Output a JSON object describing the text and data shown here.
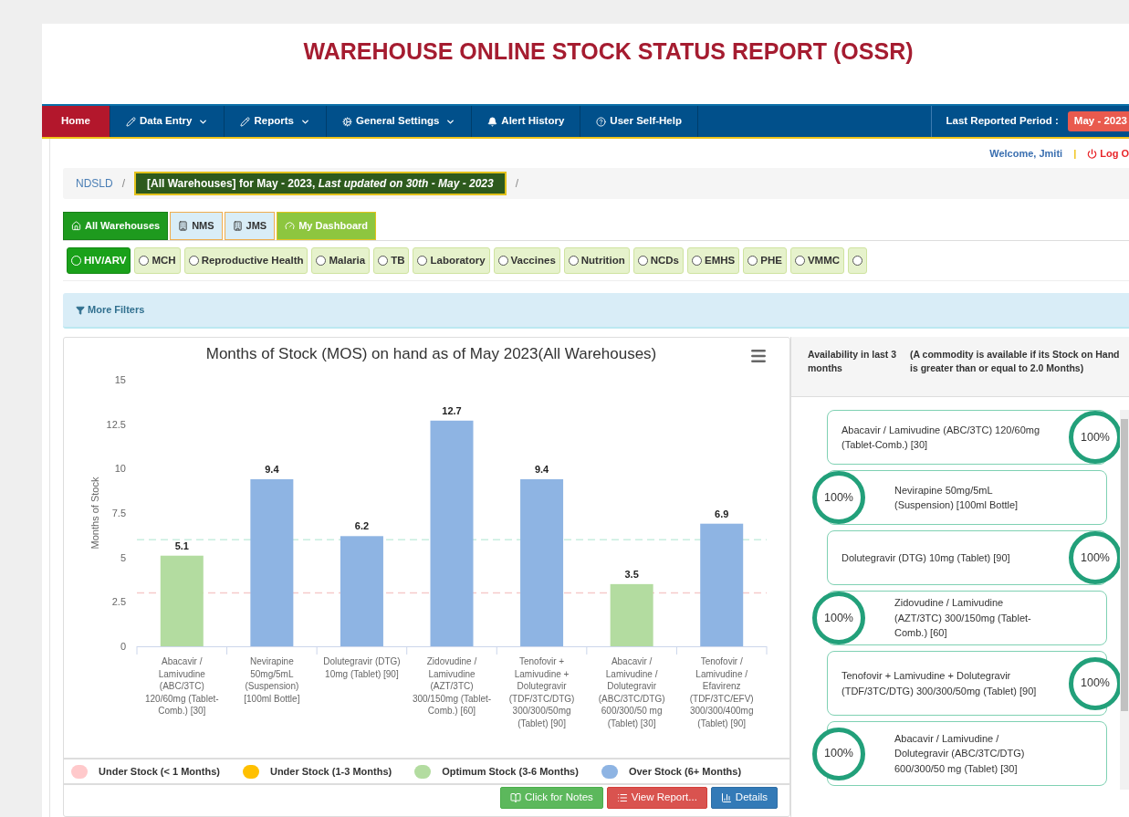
{
  "page_title": "WAREHOUSE ONLINE STOCK STATUS REPORT (OSSR)",
  "nav": {
    "items": [
      {
        "label": "Home",
        "selected": true,
        "dropdown": false
      },
      {
        "label": "Data Entry",
        "selected": false,
        "dropdown": true
      },
      {
        "label": "Reports",
        "selected": false,
        "dropdown": true
      },
      {
        "label": "General Settings",
        "selected": false,
        "dropdown": true
      },
      {
        "label": "Alert History",
        "selected": false,
        "dropdown": false
      },
      {
        "label": "User Self-Help",
        "selected": false,
        "dropdown": false
      }
    ],
    "period_label": "Last Reported Period :",
    "period_value": "May - 2023"
  },
  "user": {
    "welcome": "Welcome, Jmiti",
    "separator": "|",
    "logout": "Log O"
  },
  "breadcrumb": {
    "root": "NDSLD",
    "separator": "/",
    "current": "[All Warehouses] for May - 2023, *Last updated on 30th - May - 2023*",
    "trailing": "/"
  },
  "warehouse_tabs": [
    {
      "label": "All Warehouses",
      "kind": "warehouse",
      "selected": true
    },
    {
      "label": "NMS",
      "kind": "warehouse",
      "selected": false
    },
    {
      "label": "JMS",
      "kind": "warehouse",
      "selected": false
    },
    {
      "label": "My Dashboard",
      "kind": "dashboard",
      "selected": false
    }
  ],
  "programs": [
    {
      "label": "HIV/ARV",
      "selected": true
    },
    {
      "label": "MCH",
      "selected": false
    },
    {
      "label": "Reproductive Health",
      "selected": false
    },
    {
      "label": "Malaria",
      "selected": false
    },
    {
      "label": "TB",
      "selected": false
    },
    {
      "label": "Laboratory",
      "selected": false
    },
    {
      "label": "Vaccines",
      "selected": false
    },
    {
      "label": "Nutrition",
      "selected": false
    },
    {
      "label": "NCDs",
      "selected": false
    },
    {
      "label": "EMHS",
      "selected": false
    },
    {
      "label": "PHE",
      "selected": false
    },
    {
      "label": "VMMC",
      "selected": false
    },
    {
      "selected": false
    }
  ],
  "filters": {
    "label": "More Filters"
  },
  "chart_panel": {
    "chart_data": {
      "type": "bar",
      "title": "Months of Stock (MOS) on hand as of May 2023(All Warehouses)",
      "ylabel": "Months of Stock",
      "categories": [
        "Abacavir / Lamivudine (ABC/3TC) 120/60mg (Tablet-Comb.) [30]",
        "Nevirapine 50mg/5mL (Suspension) [100ml Bottle]",
        "Dolutegravir (DTG) 10mg (Tablet) [90]",
        "Zidovudine / Lamivudine (AZT/3TC) 300/150mg (Tablet-Comb.) [60]",
        "Tenofovir + Lamivudine + Dolutegravir (TDF/3TC/DTG) 300/300/50mg (Tablet) [90]",
        "Abacavir / Lamivudine / Dolutegravir (ABC/3TC/DTG) 600/300/50 mg (Tablet) [30]",
        "Tenofovir / Lamivudine / Efavirenz (TDF/3TC/EFV) 300/300/400mg (Tablet) [90]"
      ],
      "series": [
        {
          "name": "Under Stock (< 1 Months)",
          "color": "#ffc9cb",
          "values": [
            null,
            null,
            null,
            null,
            null,
            null,
            null
          ]
        },
        {
          "name": "Under Stock (1-3 Months)",
          "color": "#ffc000",
          "values": [
            null,
            null,
            null,
            null,
            null,
            null,
            null
          ]
        },
        {
          "name": "Optimum Stock (3-6 Months)",
          "color": "#b3dca0",
          "values": [
            5.1,
            null,
            null,
            null,
            null,
            3.5,
            null
          ]
        },
        {
          "name": "Over Stock (6+ Months)",
          "color": "#8eb4e3",
          "values": [
            null,
            9.4,
            6.2,
            12.7,
            9.4,
            null,
            6.9
          ]
        }
      ],
      "ylim": [
        0,
        15
      ],
      "yticks": [
        0,
        2.5,
        5,
        7.5,
        10,
        12.5,
        15
      ],
      "data_labels": true,
      "ref_lines": [
        {
          "axis": "y",
          "value": 3,
          "color": "#f6caca"
        },
        {
          "axis": "y",
          "value": 6,
          "color": "#c8eee0"
        }
      ]
    },
    "buttons": [
      {
        "label": "Click for Notes",
        "kind": "notes"
      },
      {
        "label": "View Report...",
        "kind": "report"
      },
      {
        "label": "Details",
        "kind": "details"
      }
    ]
  },
  "availability": {
    "title": "Availability in last 3 months",
    "note": "(A commodity is available if its Stock on Hand is greater than or equal to 2.0 Months)",
    "items": [
      {
        "name": "Abacavir / Lamivudine (ABC/3TC) 120/60mg (Tablet-Comb.) [30]",
        "percent": "100%"
      },
      {
        "name": "Nevirapine 50mg/5mL (Suspension) [100ml Bottle]",
        "percent": "100%"
      },
      {
        "name": "Dolutegravir (DTG) 10mg (Tablet) [90]",
        "percent": "100%"
      },
      {
        "name": "Zidovudine / Lamivudine (AZT/3TC) 300/150mg (Tablet-Comb.) [60]",
        "percent": "100%"
      },
      {
        "name": "Tenofovir + Lamivudine + Dolutegravir (TDF/3TC/DTG) 300/300/50mg (Tablet) [90]",
        "percent": "100%"
      },
      {
        "name": "Abacavir / Lamivudine / Dolutegravir (ABC/3TC/DTG) 600/300/50 mg (Tablet) [30]",
        "percent": "100%"
      }
    ]
  }
}
